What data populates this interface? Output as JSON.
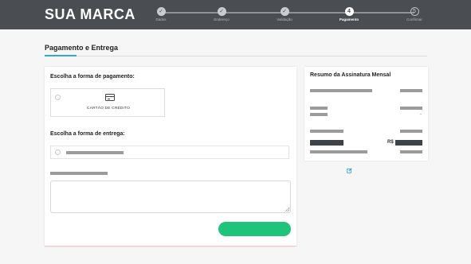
{
  "header": {
    "brand": "SUA MARCA",
    "steps": [
      {
        "number": "✓",
        "label": "Dados",
        "state": "done"
      },
      {
        "number": "✓",
        "label": "Endereço",
        "state": "done"
      },
      {
        "number": "✓",
        "label": "Validação",
        "state": "done"
      },
      {
        "number": "4",
        "label": "Pagamento",
        "state": "current"
      },
      {
        "number": "5",
        "label": "Confirmar",
        "state": "todo"
      }
    ]
  },
  "section": {
    "title": "Pagamento e Entrega"
  },
  "payment": {
    "question": "Escolha a forma de pagamento:",
    "options": [
      {
        "label": "CARTÃO DE CRÉDITO",
        "icon": "credit-card-icon"
      }
    ]
  },
  "shipping": {
    "question": "Escolha a forma de entrega:"
  },
  "summary": {
    "title": "Resumo da Assinatura Mensal",
    "dash": "-",
    "currency": "R$"
  },
  "colors": {
    "header_bg": "#4a4d52",
    "accent": "#2ea9d9",
    "button": "#1fc37a"
  }
}
